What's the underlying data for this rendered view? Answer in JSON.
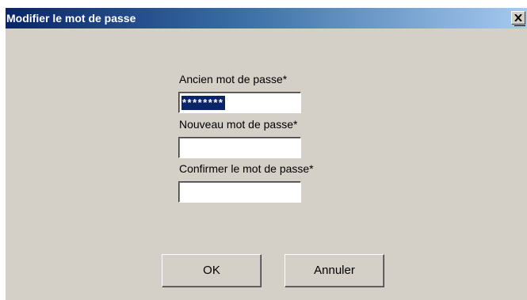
{
  "window": {
    "title": "Modifier le mot de passe",
    "close_label": "X"
  },
  "form": {
    "old_password": {
      "label": "Ancien mot de passe*",
      "value": "********"
    },
    "new_password": {
      "label": "Nouveau mot de passe*",
      "value": ""
    },
    "confirm_password": {
      "label": "Confirmer le mot de passe*",
      "value": ""
    }
  },
  "buttons": {
    "ok_label": "OK",
    "cancel_label": "Annuler"
  },
  "colors": {
    "title_bar_start": "#0a246a",
    "title_bar_end": "#a6caf0",
    "dialog_background": "#d4d0c8",
    "selection_highlight": "#0a246a"
  },
  "icons": {
    "close": "close-icon"
  }
}
